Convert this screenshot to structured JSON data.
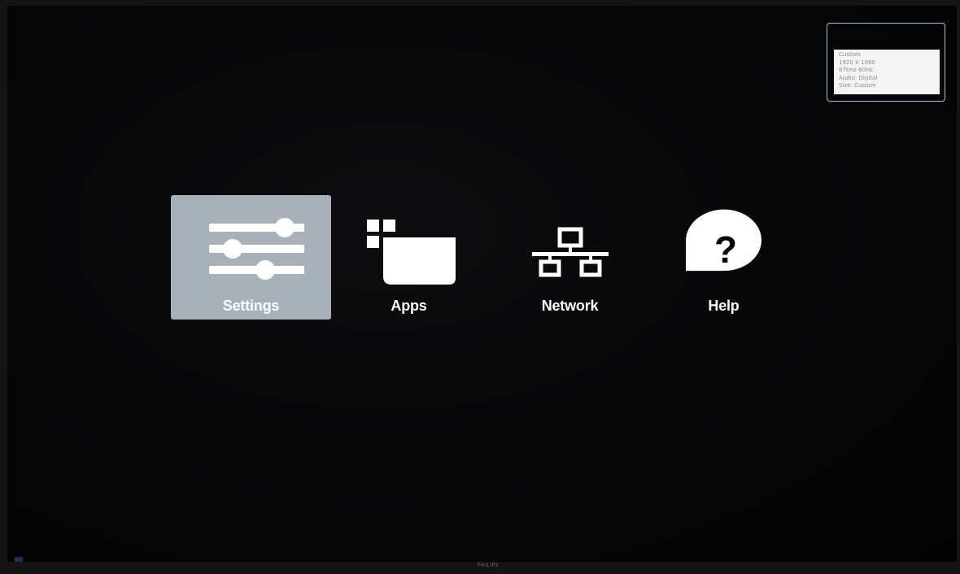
{
  "info_panel": {
    "lines": [
      "Custom",
      "1920 X 1080",
      "67kHz 60Hz",
      "Audio: Digital",
      "Size: Custom"
    ]
  },
  "menu": {
    "items": [
      {
        "label": "Settings",
        "icon": "sliders-icon",
        "selected": true
      },
      {
        "label": "Apps",
        "icon": "apps-icon",
        "selected": false
      },
      {
        "label": "Network",
        "icon": "network-icon",
        "selected": false
      },
      {
        "label": "Help",
        "icon": "help-icon",
        "selected": false
      }
    ]
  },
  "brand": {
    "text": "PHILIPS"
  },
  "colors": {
    "background": "#050506",
    "selected_tile": "#a8b0b9",
    "text": "#ffffff",
    "info_border": "#9ec4d8"
  }
}
